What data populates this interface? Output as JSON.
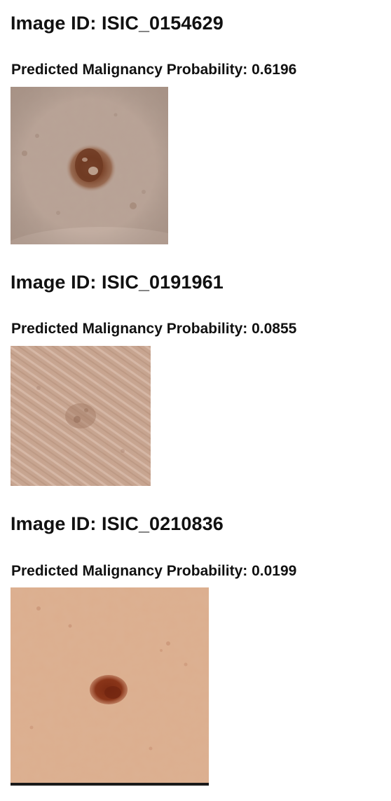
{
  "results": [
    {
      "title": "Image ID: ISIC_0154629",
      "probability_text": "Predicted Malignancy Probability: 0.6196",
      "probability": 0.6196
    },
    {
      "title": "Image ID: ISIC_0191961",
      "probability_text": "Predicted Malignancy Probability: 0.0855",
      "probability": 0.0855
    },
    {
      "title": "Image ID: ISIC_0210836",
      "probability_text": "Predicted Malignancy Probability: 0.0199",
      "probability": 0.0199
    }
  ]
}
